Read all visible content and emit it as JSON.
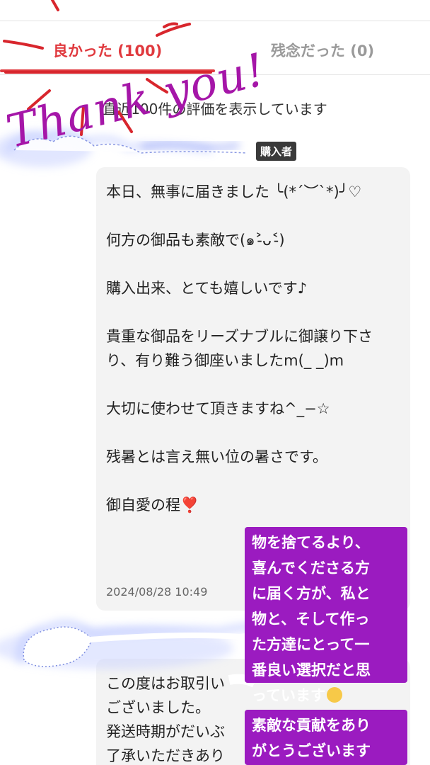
{
  "tabs": {
    "good": "良かった (100)",
    "bad": "残念だった (0)"
  },
  "notice": "直近100件の評価を表示しています",
  "reviewer": {
    "badge": "購入者"
  },
  "reviews": [
    {
      "text": "本日、無事に届きました ╰(*´︶`*)╯♡\n\n何方の御品も素敵で(๑˃̵ᴗ˂̵)\n\n購入出来、とても嬉しいです♪\n\n貴重な御品をリーズナブルに御譲り下さり、有り難う御座いましたm(_ _)m\n\n大切に使わせて頂きますね^_−☆\n\n残暑とは言え無い位の暑さです。\n\n御自愛の程",
      "heart": "❣️",
      "date": "2024/08/28 10:49"
    },
    {
      "text": "この度はお取引い\nございました。\n発送時期がだいぶ\n了承いただきあり"
    }
  ],
  "overlay": {
    "thank_you": "Thank you!",
    "caption_1": "物を捨てるより、\n喜んでくださる方\nに届く方が、私と\n物と、そして作っ\nた方達にとって一\n番良い選択だと思\nっています",
    "caption_2": "素敵な貢献をあり\nがとうございます",
    "accent_color": "#e0393e",
    "caption_color": "#9b1bc0",
    "handwriting_color": "#a516a8"
  }
}
